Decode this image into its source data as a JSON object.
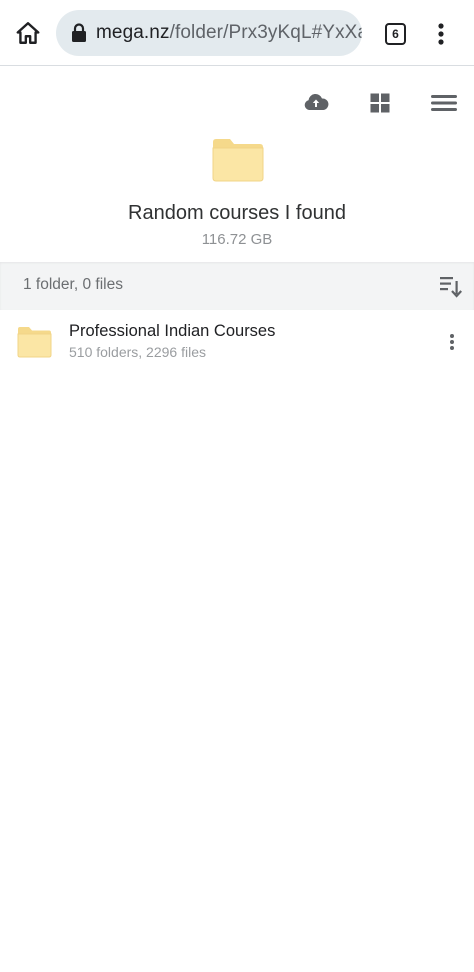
{
  "browser": {
    "url_host": "mega.nz",
    "url_path": "/folder/Prx3yKqL#YxXa",
    "tab_count": "6",
    "icons": [
      "home-icon",
      "lock-icon",
      "tabs-icon",
      "more-vert-icon"
    ]
  },
  "toolbar": {
    "icons": [
      "cloud-upload-icon",
      "grid-view-icon",
      "hamburger-menu-icon"
    ]
  },
  "folder": {
    "title": "Random courses I found",
    "size": "116.72 GB"
  },
  "summary": {
    "text": "1 folder, 0 files"
  },
  "items": [
    {
      "name": "Professional Indian Courses",
      "meta": "510 folders, 2296 files",
      "icon": "folder-icon"
    }
  ],
  "colors": {
    "folder_fill": "#fbe6a5",
    "folder_tab": "#f5d98b",
    "url_bg": "#e3eaee",
    "summary_bg": "#f3f4f5",
    "icon_gray": "#5f6266"
  }
}
